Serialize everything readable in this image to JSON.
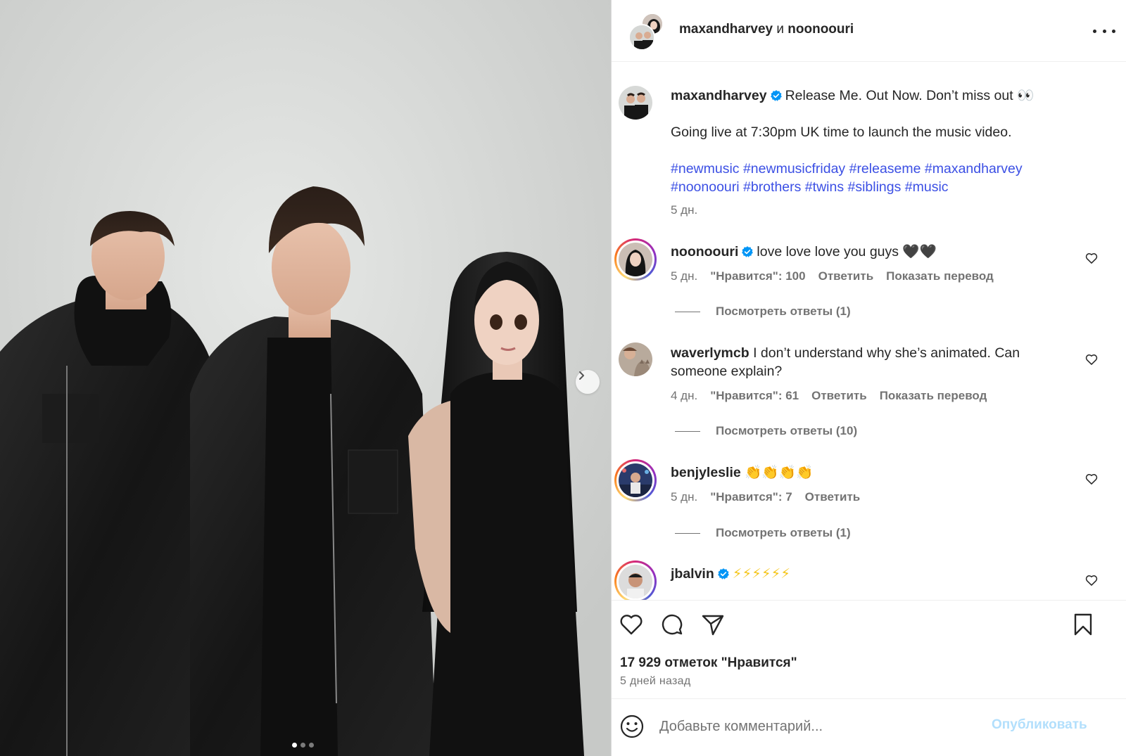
{
  "header": {
    "author1": "maxandharvey",
    "separator": "и",
    "author2": "noonoouri"
  },
  "caption": {
    "username": "maxandharvey",
    "line1": "Release Me. Out Now. Don’t miss out 👀",
    "line2": "Going live at 7:30pm UK time to launch the music video.",
    "hashtags_line1": "#newmusic #newmusicfriday #releaseme #maxandharvey",
    "hashtags_line2": "#noonoouri #brothers #twins #siblings #music",
    "time": "5 дн."
  },
  "comments": [
    {
      "username": "noonoouri",
      "text": "love love love you guys 🖤🖤",
      "time": "5 дн.",
      "likes": "\"Нравится\": 100",
      "reply": "Ответить",
      "translate": "Показать перевод",
      "view_replies": "Посмотреть ответы (1)"
    },
    {
      "username": "waverlymcb",
      "text_line1": "I don’t understand why she’s animated. Can",
      "text_line2": "someone explain?",
      "time": "4 дн.",
      "likes": "\"Нравится\": 61",
      "reply": "Ответить",
      "translate": "Показать перевод",
      "view_replies": "Посмотреть ответы (10)"
    },
    {
      "username": "benjyleslie",
      "text": "👏👏👏👏",
      "time": "5 дн.",
      "likes": "\"Нравится\": 7",
      "reply": "Ответить",
      "view_replies": "Посмотреть ответы (1)"
    },
    {
      "username": "jbalvin",
      "text": "⚡⚡⚡⚡⚡⚡"
    }
  ],
  "likes_summary": "17 929 отметок \"Нравится\"",
  "posted_ago": "5 дней назад",
  "comment_box": {
    "placeholder": "Добавьте комментарий...",
    "publish_label": "Опубликовать"
  },
  "carousel": {
    "current": 1,
    "total": 3
  },
  "colors": {
    "hashtag": "#3b4fe4",
    "verified": "#0095f6",
    "muted": "#737373",
    "publish_disabled": "#b2dffc"
  }
}
